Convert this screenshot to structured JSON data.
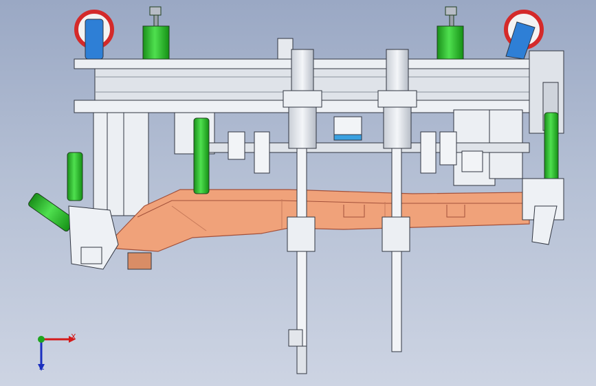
{
  "viewport": {
    "background_top": "#9aa8c4",
    "background_bottom": "#cdd4e3"
  },
  "part": {
    "color": "#f0a27a",
    "edge_color": "#a2503a"
  },
  "cylinder_color": "#22b422",
  "wheel_color": "#2e7fd6",
  "wheel_rim_color": "#d42a2a",
  "triad": {
    "x_label": "X",
    "z_label": "Z",
    "x_color": "#d41a1a",
    "y_color": "#1fa51f",
    "z_color": "#1a2fbf"
  }
}
